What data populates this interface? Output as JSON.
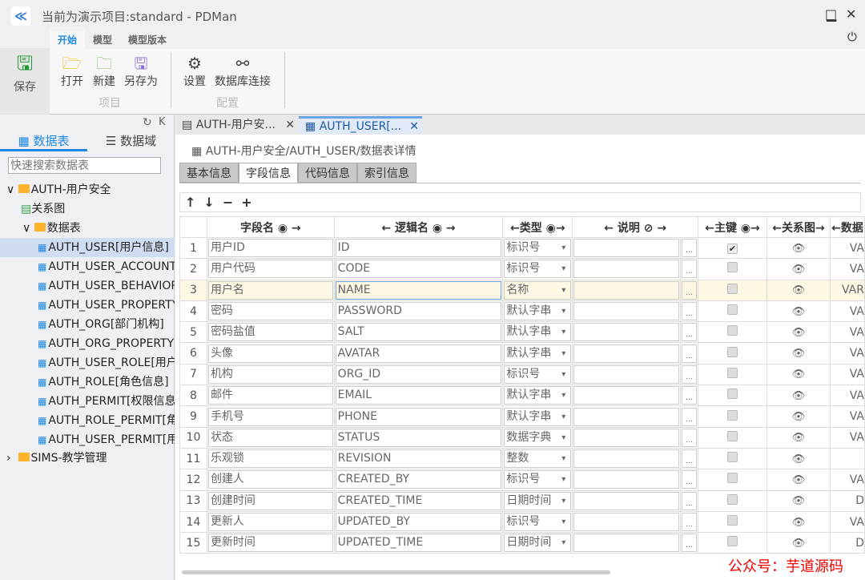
{
  "window": {
    "title": "当前为演示项目:standard - PDMan",
    "minimize": "▁",
    "maximize": "□",
    "close": "✕",
    "logout": "⏻"
  },
  "ribbon": {
    "tabs": [
      "开始",
      "模型",
      "模型版本"
    ],
    "save": "保存",
    "buttons": [
      {
        "label": "打开",
        "icon": "folder-open-icon"
      },
      {
        "label": "新建",
        "icon": "folder-add-icon"
      },
      {
        "label": "另存为",
        "icon": "save-as-icon"
      },
      {
        "label": "设置",
        "icon": "gear-icon"
      },
      {
        "label": "数据库连接",
        "icon": "link-icon"
      }
    ],
    "groups": [
      "项目",
      "配置"
    ]
  },
  "sidebar": {
    "tabs": [
      "数据表",
      "数据域"
    ],
    "search_placeholder": "快速搜索数据表",
    "tree": {
      "module1": "AUTH-用户安全",
      "diagram": "关系图",
      "tables_folder": "数据表",
      "tables": [
        "AUTH_USER[用户信息]",
        "AUTH_USER_ACCOUNT[",
        "AUTH_USER_BEHAVIOR[",
        "AUTH_USER_PROPERTY[",
        "AUTH_ORG[部门机构]",
        "AUTH_ORG_PROPERTY[机",
        "AUTH_USER_ROLE[用户角",
        "AUTH_ROLE[角色信息]",
        "AUTH_PERMIT[权限信息",
        "AUTH_ROLE_PERMIT[角色",
        "AUTH_USER_PERMIT[用户"
      ],
      "module2": "SIMS-教学管理"
    }
  },
  "doc_tabs": [
    "AUTH-用户安...",
    "AUTH_USER[..."
  ],
  "breadcrumb": "AUTH-用户安全/AUTH_USER/数据表详情",
  "sub_tabs": [
    "基本信息",
    "字段信息",
    "代码信息",
    "索引信息"
  ],
  "toolbar": [
    "↑",
    "↓",
    "−",
    "+"
  ],
  "grid": {
    "headers": [
      "字段名 ◉     →",
      "←   逻辑名 ◉    →",
      "←类型 ◉→",
      "←   说明 ⊘   →",
      "",
      "←主键 ◉→",
      "←关系图→",
      "←数据"
    ],
    "rows": [
      [
        "1",
        "用户ID",
        "ID",
        "标识号",
        true,
        "VA"
      ],
      [
        "2",
        "用户代码",
        "CODE",
        "标识号",
        false,
        "VA"
      ],
      [
        "3",
        "用户名",
        "NAME",
        "名称",
        false,
        "VAR"
      ],
      [
        "4",
        "密码",
        "PASSWORD",
        "默认字串",
        false,
        "VA"
      ],
      [
        "5",
        "密码盐值",
        "SALT",
        "默认字串",
        false,
        "VA"
      ],
      [
        "6",
        "头像",
        "AVATAR",
        "默认字串",
        false,
        "VA"
      ],
      [
        "7",
        "机构",
        "ORG_ID",
        "标识号",
        false,
        "VA"
      ],
      [
        "8",
        "邮件",
        "EMAIL",
        "默认字串",
        false,
        "VA"
      ],
      [
        "9",
        "手机号",
        "PHONE",
        "默认字串",
        false,
        "VA"
      ],
      [
        "10",
        "状态",
        "STATUS",
        "数据字典",
        false,
        "VA"
      ],
      [
        "11",
        "乐观锁",
        "REVISION",
        "整数",
        false,
        ""
      ],
      [
        "12",
        "创建人",
        "CREATED_BY",
        "标识号",
        false,
        "VA"
      ],
      [
        "13",
        "创建时间",
        "CREATED_TIME",
        "日期时间",
        false,
        "D"
      ],
      [
        "14",
        "更新人",
        "UPDATED_BY",
        "标识号",
        false,
        "VA"
      ],
      [
        "15",
        "更新时间",
        "UPDATED_TIME",
        "日期时间",
        false,
        "D"
      ]
    ]
  },
  "watermark": "公众号：芋道源码"
}
